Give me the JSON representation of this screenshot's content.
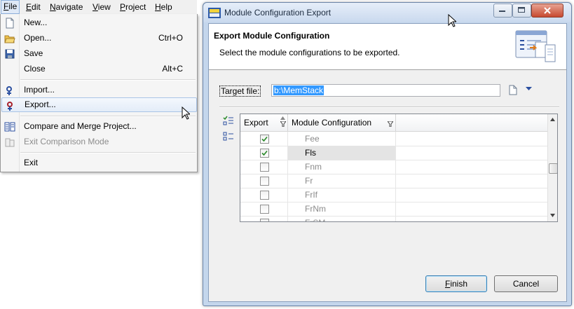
{
  "menubar": {
    "items": [
      {
        "label": "File",
        "mnemonic": "F",
        "rest": "ile"
      },
      {
        "label": "Edit",
        "mnemonic": "E",
        "rest": "dit"
      },
      {
        "label": "Navigate",
        "mnemonic": "N",
        "rest": "avigate"
      },
      {
        "label": "View",
        "mnemonic": "V",
        "rest": "iew"
      },
      {
        "label": "Project",
        "mnemonic": "P",
        "rest": "roject"
      },
      {
        "label": "Help",
        "mnemonic": "H",
        "rest": "elp"
      }
    ]
  },
  "file_menu": {
    "items": [
      {
        "label": "New...",
        "shortcut": "",
        "icon": "new-file-icon"
      },
      {
        "label": "Open...",
        "shortcut": "Ctrl+O",
        "icon": "open-folder-icon"
      },
      {
        "label": "Save",
        "shortcut": "",
        "icon": "save-disk-icon"
      },
      {
        "label": "Close",
        "shortcut": "Alt+C",
        "icon": ""
      },
      {
        "label": "Import...",
        "shortcut": "",
        "icon": "import-icon"
      },
      {
        "label": "Export...",
        "shortcut": "",
        "icon": "export-icon"
      },
      {
        "label": "Compare and Merge Project...",
        "shortcut": "",
        "icon": "compare-merge-icon"
      },
      {
        "label": "Exit Comparison Mode",
        "shortcut": "",
        "icon": "exit-compare-icon"
      },
      {
        "label": "Exit",
        "shortcut": "",
        "icon": ""
      }
    ]
  },
  "dialog": {
    "title": "Module Configuration Export",
    "banner_title": "Export Module Configuration",
    "banner_description": "Select the module configurations to be exported.",
    "target_file_label": "Target file:",
    "target_file_value": "b:\\MemStack",
    "table": {
      "columns": [
        "Export",
        "Module Configuration"
      ],
      "rows": [
        {
          "name": "Fee",
          "checked": true
        },
        {
          "name": "Fls",
          "checked": true
        },
        {
          "name": "Fnm",
          "checked": false
        },
        {
          "name": "Fr",
          "checked": false
        },
        {
          "name": "FrIf",
          "checked": false
        },
        {
          "name": "FrNm",
          "checked": false
        },
        {
          "name": "FrSM",
          "checked": false
        }
      ]
    },
    "finish_label": "Finish",
    "finish_mnemonic": "F",
    "finish_rest": "inish",
    "cancel_label": "Cancel"
  },
  "colors": {
    "selection": "#3399ff",
    "menu_hover": "#dfe9f7",
    "dialog_frame": "#c4d6ec",
    "check_green": "#2a8a2a"
  }
}
